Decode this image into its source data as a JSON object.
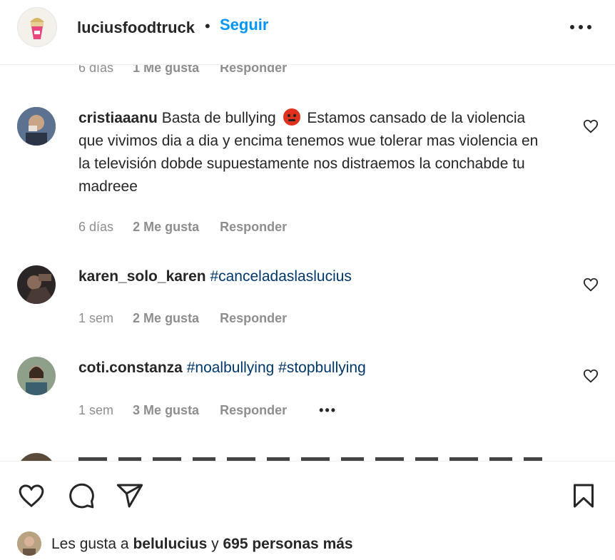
{
  "post_header": {
    "username": "luciusfoodtruck",
    "separator": "•",
    "follow_label": "Seguir"
  },
  "top_meta": {
    "time": "6 días",
    "likes": "1 Me gusta",
    "reply": "Responder"
  },
  "comments": [
    {
      "username": "cristiaaanu",
      "text_before_emoji": "Basta de bullying",
      "emoji": "angry-face-emoji",
      "text_after_emoji": "Estamos cansado de la violencia que vivimos dia a dia y encima tenemos wue tolerar mas violencia en la televisión dobde supuestamente nos distraemos la conchabde tu madreee",
      "time": "6 días",
      "likes": "2 Me gusta",
      "reply": "Responder"
    },
    {
      "username": "karen_solo_karen",
      "hashtags": [
        "#canceladaslaslucius"
      ],
      "time": "1 sem",
      "likes": "2 Me gusta",
      "reply": "Responder"
    },
    {
      "username": "coti.constanza",
      "hashtags": [
        "#noalbullying",
        "#stopbullying"
      ],
      "time": "1 sem",
      "likes": "3 Me gusta",
      "reply": "Responder",
      "more": "•••"
    }
  ],
  "actions": {
    "icons": [
      "heart-icon",
      "comment-icon",
      "share-icon",
      "bookmark-icon"
    ]
  },
  "likes_summary": {
    "prefix": "Les gusta a",
    "user": "belulucius",
    "connector": "y",
    "others": "695 personas más"
  },
  "colors": {
    "link": "#0095f6",
    "hashtag": "#00376b",
    "muted": "#8e8e8e",
    "text": "#262626"
  }
}
